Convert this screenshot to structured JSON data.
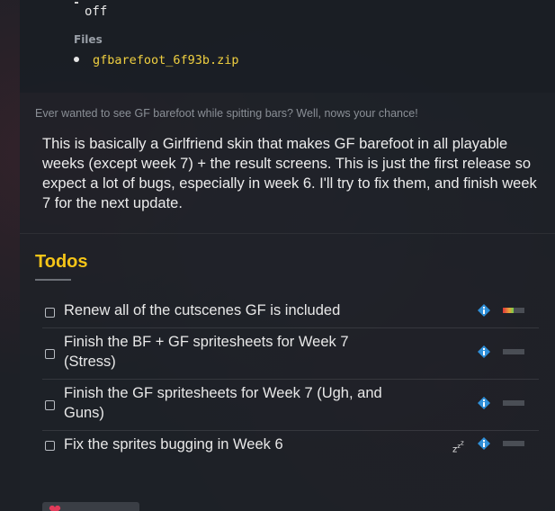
{
  "files": {
    "prev_value": "off",
    "heading": "Files",
    "items": [
      "gfbarefoot_6f93b.zip"
    ]
  },
  "tagline": "Ever wanted to see GF barefoot while spitting bars? Well, nows your chance!",
  "description": "This is basically a Girlfriend skin that makes GF barefoot in all playable weeks (except week 7) + the result screens. This is just the first release so expect a lot of bugs, especially in week 6. I'll try to fix them, and finish week 7 for the next update.",
  "todos": {
    "title": "Todos",
    "items": [
      {
        "label": "Renew all of the cutscenes GF is included",
        "info_icon": "info-diamond-icon",
        "progress": 0.5
      },
      {
        "label": "Finish the BF + GF spritesheets for Week 7 (Stress)",
        "info_icon": "info-diamond-icon",
        "progress": 0
      },
      {
        "label": "Finish the GF spritesheets for Week 7 (Ugh, and Guns)",
        "info_icon": "info-diamond-icon",
        "progress": 0
      },
      {
        "label": "Fix the sprites bugging in Week 6",
        "status_icon": "sleep-zzz-icon",
        "info_icon": "info-diamond-icon",
        "progress": 0
      }
    ]
  },
  "colors": {
    "accent_yellow": "#f5c518",
    "link": "#f0d040",
    "info_blue": "#2f8fd8"
  }
}
